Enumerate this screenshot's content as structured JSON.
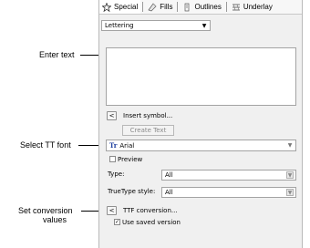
{
  "callouts": {
    "enter_text": "Enter text",
    "select_font": "Select TT font",
    "set_conversion_line1": "Set conversion",
    "set_conversion_line2": "values"
  },
  "tabs": [
    {
      "label": "Special",
      "icon": "star-icon"
    },
    {
      "label": "Fills",
      "icon": "fill-icon"
    },
    {
      "label": "Outlines",
      "icon": "outline-icon"
    },
    {
      "label": "Underlay",
      "icon": "underlay-icon"
    }
  ],
  "object_type": {
    "value": "Lettering"
  },
  "insert_symbol": {
    "button": "<",
    "label": "Insert symbol..."
  },
  "create_text": {
    "label": "Create Text"
  },
  "font": {
    "icon_glyph": "Tr",
    "value": "Arial"
  },
  "preview": {
    "label": "Preview",
    "checked": false
  },
  "type_field": {
    "label": "Type:",
    "value": "All"
  },
  "truetype_style": {
    "label": "TrueType style:",
    "value": "All"
  },
  "ttf_conversion": {
    "button": "<",
    "label": "TTF conversion..."
  },
  "use_saved": {
    "label": "Use saved version",
    "checked": true
  },
  "colors": {
    "panel_bg": "#f0f0f0",
    "border": "#a3a3a3",
    "disabled_text": "#8a8a8a"
  }
}
